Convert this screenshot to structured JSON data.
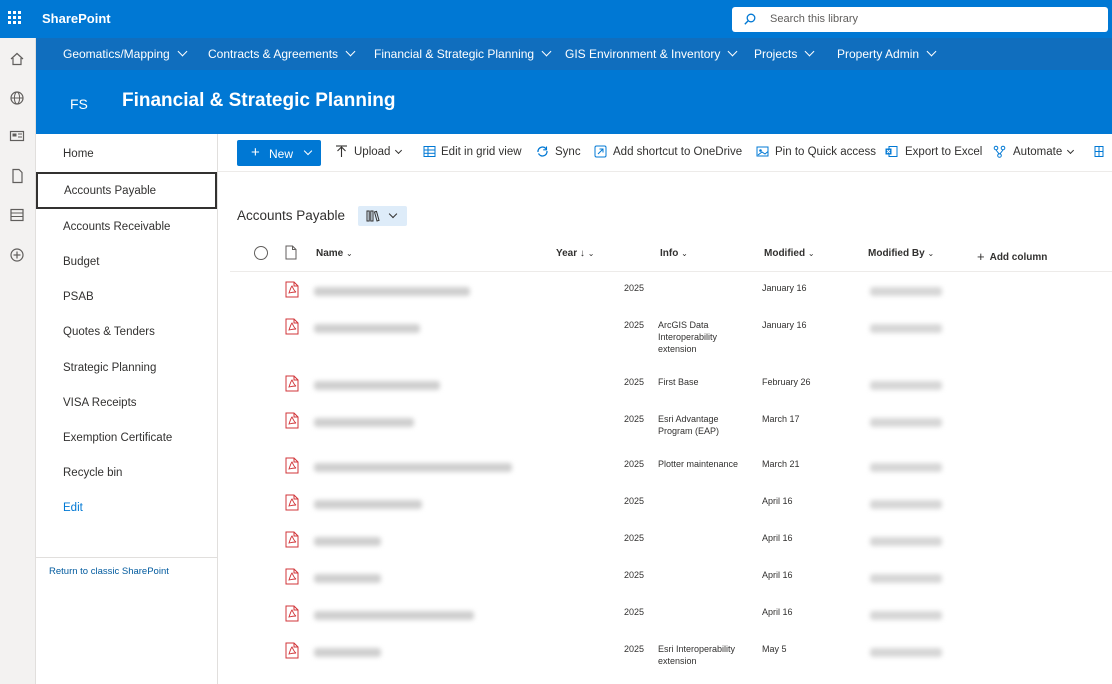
{
  "suite": {
    "brand": "SharePoint",
    "search_placeholder": "Search this library"
  },
  "hubnav": [
    {
      "label": "Geomatics/Mapping"
    },
    {
      "label": "Contracts & Agreements"
    },
    {
      "label": "Financial & Strategic Planning"
    },
    {
      "label": "GIS Environment & Inventory"
    },
    {
      "label": "Projects"
    },
    {
      "label": "Property Admin"
    }
  ],
  "site": {
    "logo_initials": "FS",
    "title": "Financial & Strategic Planning"
  },
  "leftnav": {
    "items": [
      "Home",
      "Accounts Payable",
      "Accounts Receivable",
      "Budget",
      "PSAB",
      "Quotes & Tenders",
      "Strategic Planning",
      "VISA Receipts",
      "Exemption Certificate",
      "Recycle bin"
    ],
    "selected": "Accounts Payable",
    "edit": "Edit",
    "return_link": "Return to classic SharePoint"
  },
  "commands": {
    "new": "New",
    "upload": "Upload",
    "grid": "Edit in grid view",
    "sync": "Sync",
    "shortcut": "Add shortcut to OneDrive",
    "pin": "Pin to Quick access",
    "export": "Export to Excel",
    "automate": "Automate"
  },
  "library": {
    "title": "Accounts Payable"
  },
  "columns": {
    "name": "Name",
    "year": "Year",
    "info": "Info",
    "modified": "Modified",
    "modified_by": "Modified By",
    "add_column": "Add column"
  },
  "rows": [
    {
      "year": "2025",
      "info": "",
      "modified": "January 16"
    },
    {
      "year": "2025",
      "info": "ArcGIS Data Interoperability extension",
      "modified": "January 16"
    },
    {
      "year": "2025",
      "info": "First Base",
      "modified": "February 26"
    },
    {
      "year": "2025",
      "info": "Esri Advantage Program (EAP)",
      "modified": "March 17"
    },
    {
      "year": "2025",
      "info": "Plotter maintenance",
      "modified": "March 21"
    },
    {
      "year": "2025",
      "info": "",
      "modified": "April 16"
    },
    {
      "year": "2025",
      "info": "",
      "modified": "April 16"
    },
    {
      "year": "2025",
      "info": "",
      "modified": "April 16"
    },
    {
      "year": "2025",
      "info": "",
      "modified": "April 16"
    },
    {
      "year": "2025",
      "info": "Esri Interoperability extension",
      "modified": "May 5"
    }
  ],
  "colors": {
    "suite_bar": "#0078d4",
    "hub_nav": "#106ebe",
    "accent": "#0078d4",
    "pdf_red": "#d13438"
  }
}
